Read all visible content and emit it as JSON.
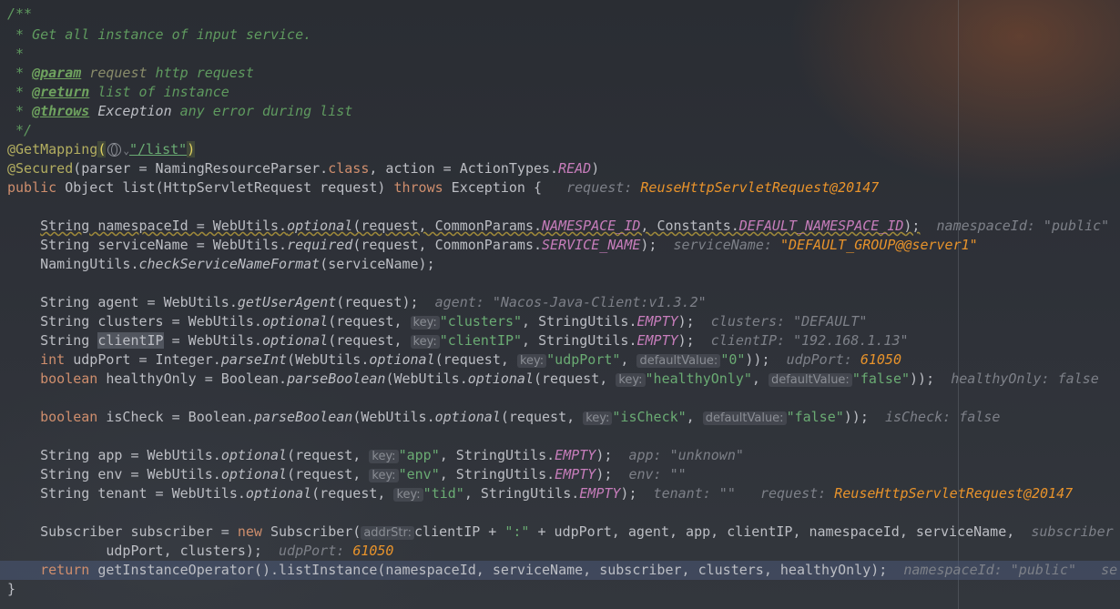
{
  "lines": {
    "c1": "/**",
    "c2": " * Get all instance of input service.",
    "c3": " *",
    "c4_pre": " * ",
    "c4_tag": "@param",
    "c4_val": " request",
    "c4_rest": " http request",
    "c5_pre": " * ",
    "c5_tag": "@return",
    "c5_rest": " list of instance",
    "c6_pre": " * ",
    "c6_tag": "@throws",
    "c6_val": " Exception",
    "c6_rest": " any error during list",
    "c7": " */",
    "getmapping": "@GetMapping",
    "lparen": "(",
    "list_path": "\"/list\"",
    "rparen": ")",
    "secured": "@Secured",
    "secured_rest": "(parser = NamingResourceParser.",
    "kw_class": "class",
    "secured_rest2": ", action = ActionTypes.",
    "read": "READ",
    "secured_end": ")",
    "kw_public": "public",
    "sig": " Object list(HttpServletRequest request) ",
    "kw_throws": "throws",
    "sig2": " Exception {",
    "dbg_request": "request: ",
    "dbg_request_val": "ReuseHttpServletRequest@20147",
    "ns_a": "String namespaceId = WebUtils.",
    "optional": "optional",
    "ns_b": "(request, CommonParams.",
    "ns_const": "NAMESPACE_ID",
    "ns_c": ", Constants.",
    "ns_const2": "DEFAULT_NAMESPACE_ID",
    "ns_d": ");",
    "dbg_ns": "namespaceId: \"public\"",
    "sn_a": "String serviceName = WebUtils.",
    "required": "required",
    "sn_b": "(request, CommonParams.",
    "sn_const": "SERVICE_NAME",
    "sn_c": ");",
    "dbg_sn": "serviceName: ",
    "dbg_sn_val": "\"DEFAULT_GROUP@@server1\"",
    "nu_a": "NamingUtils.",
    "check": "checkServiceNameFormat",
    "nu_b": "(serviceName);",
    "ag_a": "String agent = WebUtils.",
    "getUserAgent": "getUserAgent",
    "ag_b": "(request);",
    "dbg_agent": "agent: \"Nacos-Java-Client:v1.3.2\"",
    "cl_a": "String clusters = WebUtils.",
    "cl_b": "(request, ",
    "hint_key": "key:",
    "str_clusters": "\"clusters\"",
    "cl_c": ", StringUtils.",
    "empty": "EMPTY",
    "cl_d": ");",
    "dbg_clusters": "clusters: \"DEFAULT\"",
    "ci_a": "String ",
    "ci_sel": "clientIP",
    "ci_b": " = WebUtils.",
    "str_clientip": "\"clientIP\"",
    "dbg_clientip": "clientIP: \"192.168.1.13\"",
    "kw_int": "int",
    "up_a": " udpPort = Integer.",
    "parseInt": "parseInt",
    "up_b": "(WebUtils.",
    "up_c": "(request, ",
    "str_udpport": "\"udpPort\"",
    "up_comma": ", ",
    "hint_default": "defaultValue:",
    "str_zero": "\"0\"",
    "up_d": "));",
    "dbg_udp": "udpPort: ",
    "dbg_udp_val": "61050",
    "kw_boolean": "boolean",
    "ho_a": " healthyOnly = Boolean.",
    "parseBoolean": "parseBoolean",
    "str_healthy": "\"healthyOnly\"",
    "str_false": "\"false\"",
    "dbg_healthy": "healthyOnly: false",
    "ic_a": " isCheck = Boolean.",
    "str_ischeck": "\"isCheck\"",
    "dbg_ischeck": "isCheck: false",
    "app_a": "String app = WebUtils.",
    "str_app": "\"app\"",
    "dbg_app": "app: \"unknown\"",
    "env_a": "String env = WebUtils.",
    "str_env": "\"env\"",
    "dbg_env": "env: \"\"",
    "ten_a": "String tenant = WebUtils.",
    "str_tid": "\"tid\"",
    "dbg_tenant": "tenant: \"\"",
    "sub_a": "Subscriber subscriber = ",
    "kw_new": "new",
    "sub_b": " Subscriber(",
    "hint_addr": "addrStr:",
    "sub_c": "clientIP + ",
    "str_colon": "\":\"",
    "sub_d": " + udpPort, agent, app, clientIP, namespaceId, serviceName,",
    "dbg_sub": "subscriber",
    "sub2_a": "udpPort, clusters);",
    "kw_return": "return",
    "ret_a": " getInstanceOperator().listInstance(namespaceId, serviceName, subscriber, clusters, healthyOnly);",
    "dbg_ret": "namespaceId: \"public\"",
    "dbg_ret2": "se",
    "close": "}"
  }
}
